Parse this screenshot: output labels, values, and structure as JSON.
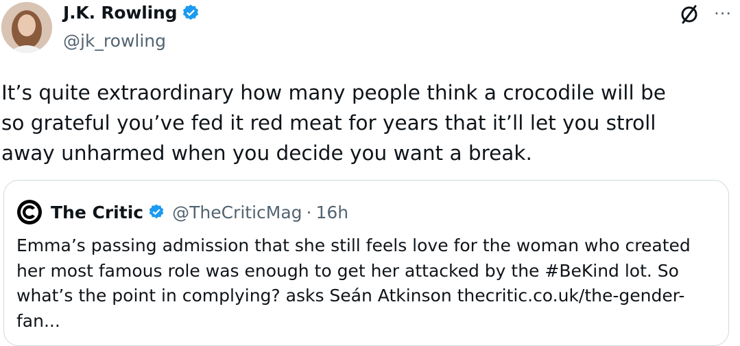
{
  "tweet": {
    "author_name": "J.K. Rowling",
    "author_handle": "@jk_rowling",
    "text": "It’s quite extraordinary how many people think a crocodile will be so grateful you’ve fed it red meat for years that it’ll let you stroll away unharmed when you decide you want a break."
  },
  "actions": {
    "more": "···",
    "slash_icon": "no-symbol-icon"
  },
  "quoted": {
    "author_name": "The Critic",
    "author_handle": "@TheCriticMag",
    "separator": "·",
    "time": "16h",
    "text": "Emma’s passing admission that she still feels love for the woman who created her most famous role was enough to get her attacked by the #BeKind lot. So what’s the point in complying? asks Seán Atkinson thecritic.co.uk/the-gender-fan..."
  },
  "colors": {
    "verified": "#1d9bf0",
    "secondary_text": "#536471",
    "border": "#cfd9de"
  }
}
